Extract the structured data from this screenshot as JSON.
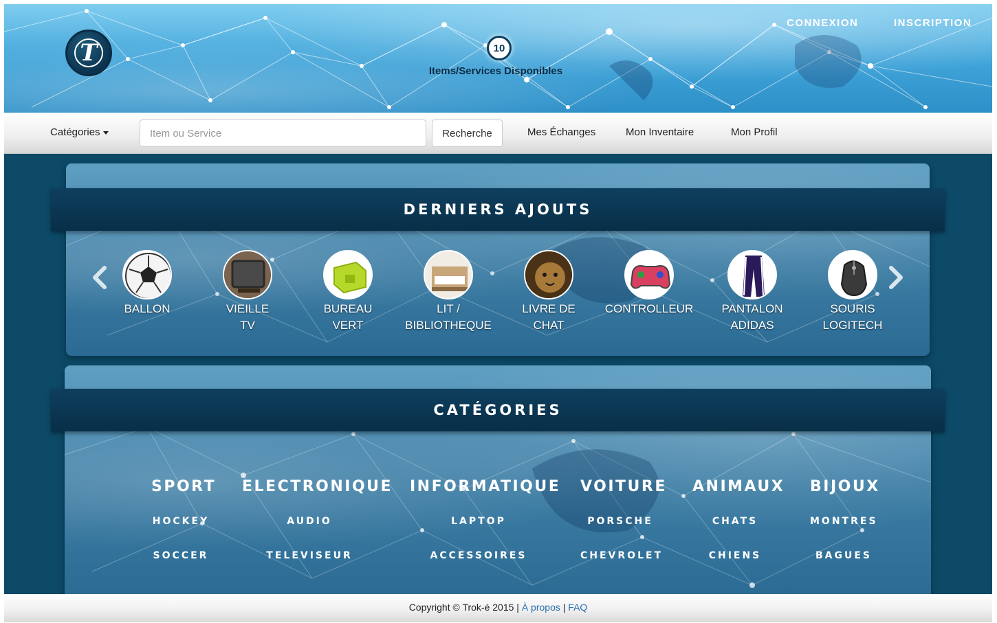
{
  "header": {
    "available_count": "10",
    "available_label": "Items/Services Disponibles",
    "login": "CONNEXION",
    "signup": "INSCRIPTION",
    "logo_letter": "T"
  },
  "nav": {
    "categories": "Catégories",
    "search_placeholder": "Item ou Service",
    "search_button": "Recherche",
    "exchanges": "Mes Échanges",
    "inventory": "Mon Inventaire",
    "profile": "Mon Profil"
  },
  "recent": {
    "title": "DERNIERS AJOUTS",
    "items": [
      {
        "line1": "BALLON",
        "line2": "",
        "icon": "soccer-ball-icon"
      },
      {
        "line1": "VIEILLE",
        "line2": "TV",
        "icon": "old-tv-icon"
      },
      {
        "line1": "BUREAU",
        "line2": "VERT",
        "icon": "green-desk-icon"
      },
      {
        "line1": "LIT /",
        "line2": "BIBLIOTHEQUE",
        "icon": "bed-shelf-icon"
      },
      {
        "line1": "LIVRE DE",
        "line2": "CHAT",
        "icon": "cat-book-icon"
      },
      {
        "line1": "CONTROLLEUR",
        "line2": "",
        "icon": "gamepad-icon"
      },
      {
        "line1": "PANTALON",
        "line2": "ADIDAS",
        "icon": "pants-icon"
      },
      {
        "line1": "SOURIS",
        "line2": "LOGITECH",
        "icon": "mouse-icon"
      }
    ]
  },
  "categories": {
    "title": "CATÉGORIES",
    "groups": [
      {
        "name": "SPORT",
        "subs": [
          "HOCKEY",
          "SOCCER"
        ]
      },
      {
        "name": "ELECTRONIQUE",
        "subs": [
          "AUDIO",
          "TELEVISEUR"
        ]
      },
      {
        "name": "INFORMATIQUE",
        "subs": [
          "LAPTOP",
          "ACCESSOIRES"
        ]
      },
      {
        "name": "VOITURE",
        "subs": [
          "PORSCHE",
          "CHEVROLET"
        ]
      },
      {
        "name": "ANIMAUX",
        "subs": [
          "CHATS",
          "CHIENS"
        ]
      },
      {
        "name": "BIJOUX",
        "subs": [
          "MONTRES",
          "BAGUES"
        ]
      }
    ]
  },
  "footer": {
    "copyright": "Copyright © Trok-é 2015 |",
    "about": "À propos",
    "separator": "|",
    "faq": "FAQ"
  },
  "colors": {
    "header_blue": "#3fa3d8",
    "page_bg": "#0c4a68",
    "band": "#082f48",
    "link_blue": "#2a6fb0"
  }
}
